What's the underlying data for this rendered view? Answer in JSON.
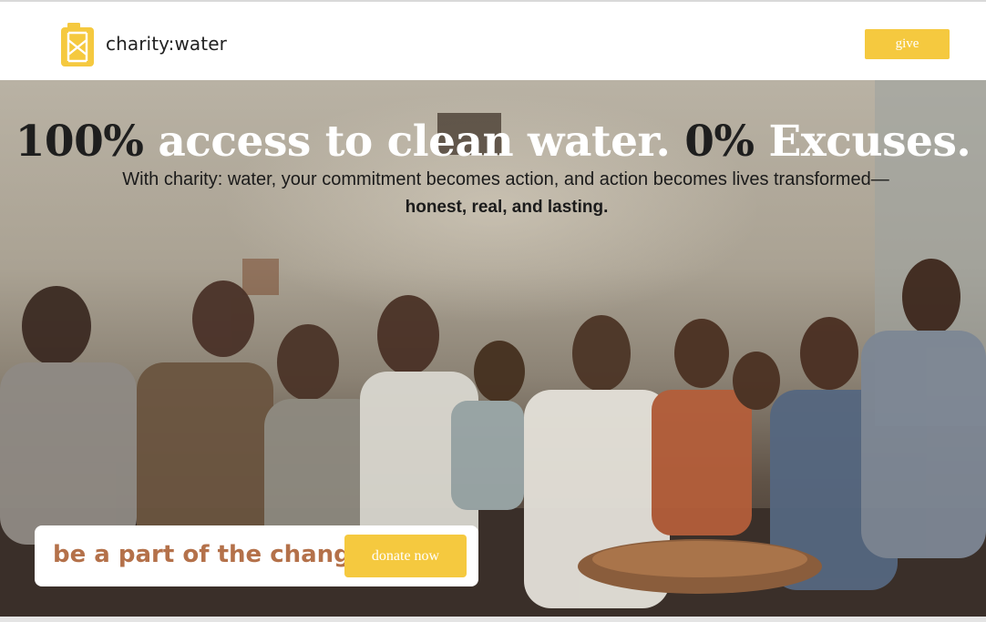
{
  "header": {
    "brand": "charity:water",
    "give_label": "give",
    "logo_icon": "jerry-can-icon"
  },
  "hero": {
    "headline_dark_1": "100%",
    "headline_light_1": " access to clean water. ",
    "headline_dark_2": "0%",
    "headline_light_2": " Excuses.",
    "subline": "With charity: water, your commitment becomes action, and action becomes lives transformed—",
    "subline_bold": "honest, real, and lasting."
  },
  "cta": {
    "text": "be a part of the change",
    "donate_label": "donate now"
  },
  "colors": {
    "accent_yellow": "#f5c93f",
    "cta_brown": "#b4714a",
    "text_dark": "#1e1e1e"
  }
}
